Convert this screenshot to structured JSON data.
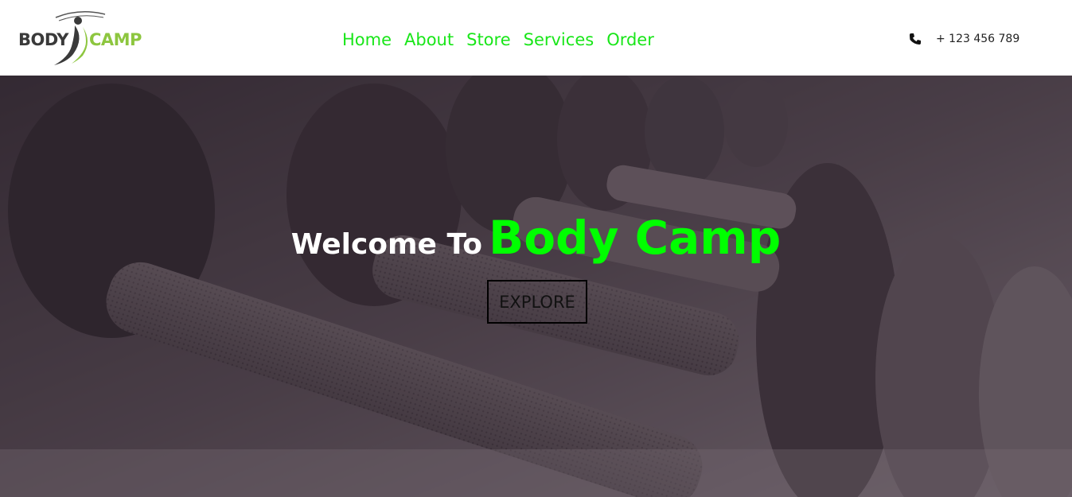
{
  "logo": {
    "word1": "BODY",
    "word2": "CAMP"
  },
  "nav": {
    "items": [
      {
        "label": "Home"
      },
      {
        "label": "About"
      },
      {
        "label": "Store"
      },
      {
        "label": "Services"
      },
      {
        "label": "Order"
      }
    ],
    "color": "#19e619"
  },
  "contact": {
    "icon": "phone-icon",
    "phone": "+ 123 456 789"
  },
  "hero": {
    "welcome": "Welcome To",
    "brand": "Body Camp",
    "brand_color": "#00ff00",
    "cta_label": "EXPLORE",
    "background": "dumbbell-rack-photo"
  }
}
